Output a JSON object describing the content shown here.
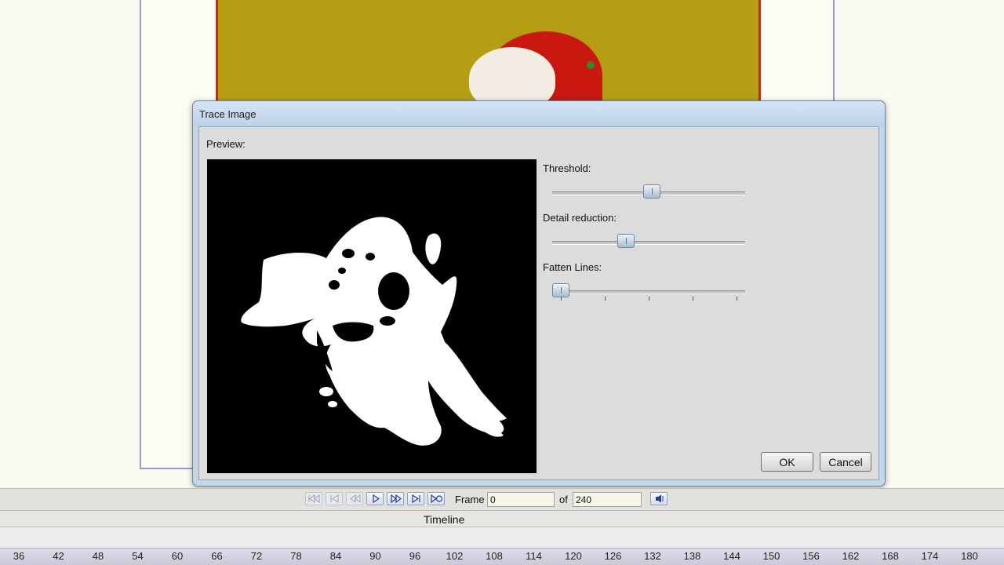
{
  "dialog": {
    "title": "Trace Image",
    "preview_label": "Preview:",
    "sliders": [
      {
        "label": "Threshold:",
        "value_fraction": 0.52,
        "ticks": false
      },
      {
        "label": "Detail reduction:",
        "value_fraction": 0.37,
        "ticks": false
      },
      {
        "label": "Fatten Lines:",
        "value_fraction": 0.0,
        "ticks": true,
        "tick_count": 5
      }
    ],
    "ok_label": "OK",
    "cancel_label": "Cancel"
  },
  "playback": {
    "buttons": [
      {
        "name": "rewind-to-start-button",
        "icon": "rewind-start-icon",
        "enabled": false
      },
      {
        "name": "first-frame-button",
        "icon": "skip-back-icon",
        "enabled": false
      },
      {
        "name": "step-back-button",
        "icon": "step-back-icon",
        "enabled": false
      },
      {
        "name": "play-button",
        "icon": "play-icon",
        "enabled": true
      },
      {
        "name": "fast-forward-button",
        "icon": "fast-forward-icon",
        "enabled": true
      },
      {
        "name": "last-frame-button",
        "icon": "skip-forward-icon",
        "enabled": true
      },
      {
        "name": "loop-button",
        "icon": "loop-end-icon",
        "enabled": true
      }
    ],
    "frame_label": "Frame",
    "frame_value": "0",
    "of_label": "of",
    "total_frames": "240",
    "sound_icon": "speaker-icon"
  },
  "timeline": {
    "title": "Timeline",
    "ruler": [
      "36",
      "42",
      "48",
      "54",
      "60",
      "66",
      "72",
      "78",
      "84",
      "90",
      "96",
      "102",
      "108",
      "114",
      "120",
      "126",
      "132",
      "138",
      "144",
      "150",
      "156",
      "162",
      "168",
      "174",
      "180"
    ]
  },
  "colors": {
    "stage_border": "#9d97cf",
    "image_border": "#e21d12",
    "dialog_frame": "#c3d7ea",
    "button_accent": "#8d9fc5"
  }
}
